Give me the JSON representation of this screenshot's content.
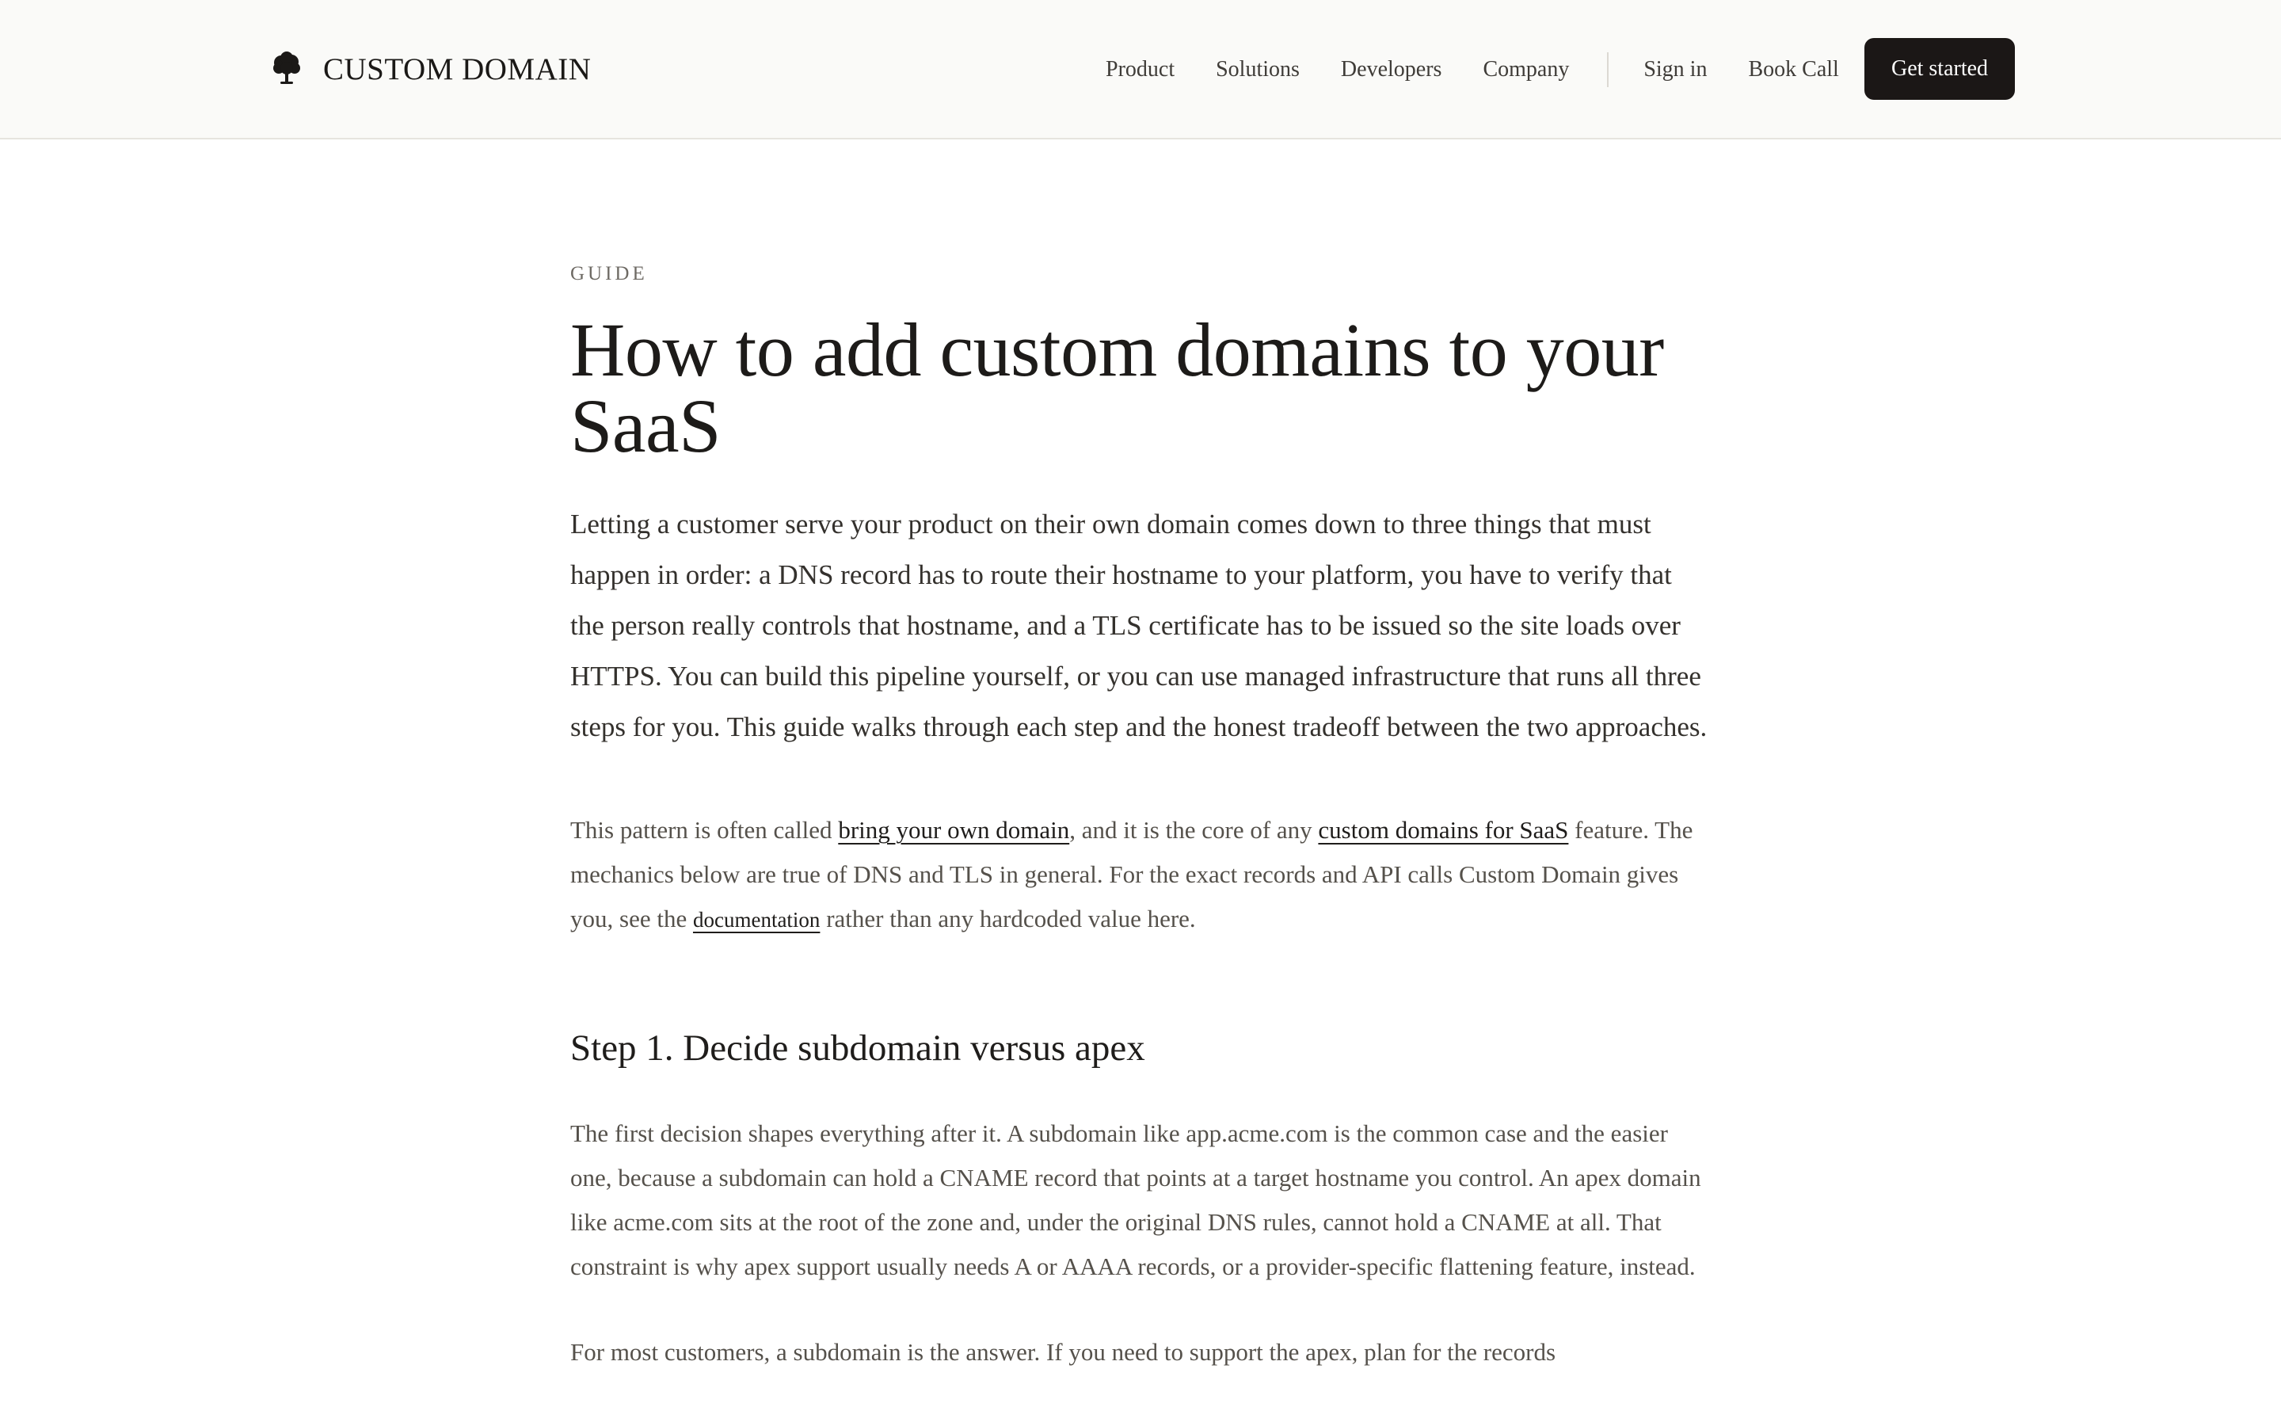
{
  "header": {
    "brand": "CUSTOM DOMAIN",
    "brand_icon": "tree-icon",
    "nav": [
      "Product",
      "Solutions",
      "Developers",
      "Company"
    ],
    "sign_in": "Sign in",
    "book_call": "Book Call",
    "cta": "Get started"
  },
  "article": {
    "eyebrow": "GUIDE",
    "title": "How to add custom domains to your SaaS",
    "lead": "Letting a customer serve your product on their own domain comes down to three things that must happen in order: a DNS record has to route their hostname to your platform, you have to verify that the person really controls that hostname, and a TLS certificate has to be issued so the site loads over HTTPS. You can build this pipeline yourself, or you can use managed infrastructure that runs all three steps for you. This guide walks through each step and the honest tradeoff between the two approaches.",
    "intro": {
      "part1": "This pattern is often called ",
      "link1": "bring your own domain",
      "part2": ", and it is the core of any ",
      "link2": "custom domains for SaaS",
      "part3": " feature. The mechanics below are true of DNS and TLS in general. For the exact records and API calls Custom Domain gives you, see the ",
      "link3": "documentation",
      "part4": " rather than any hardcoded value here."
    },
    "step1": {
      "heading": "Step 1. Decide subdomain versus apex",
      "paragraph": "The first decision shapes everything after it. A subdomain like app.acme.com is the common case and the easier one, because a subdomain can hold a CNAME record that points at a target hostname you control. An apex domain like acme.com sits at the root of the zone and, under the original DNS rules, cannot hold a CNAME at all. That constraint is why apex support usually needs A or AAAA records, or a provider-specific flattening feature, instead.",
      "next_paragraph": "For most customers, a subdomain is the answer. If you need to support the apex, plan for the records"
    }
  }
}
